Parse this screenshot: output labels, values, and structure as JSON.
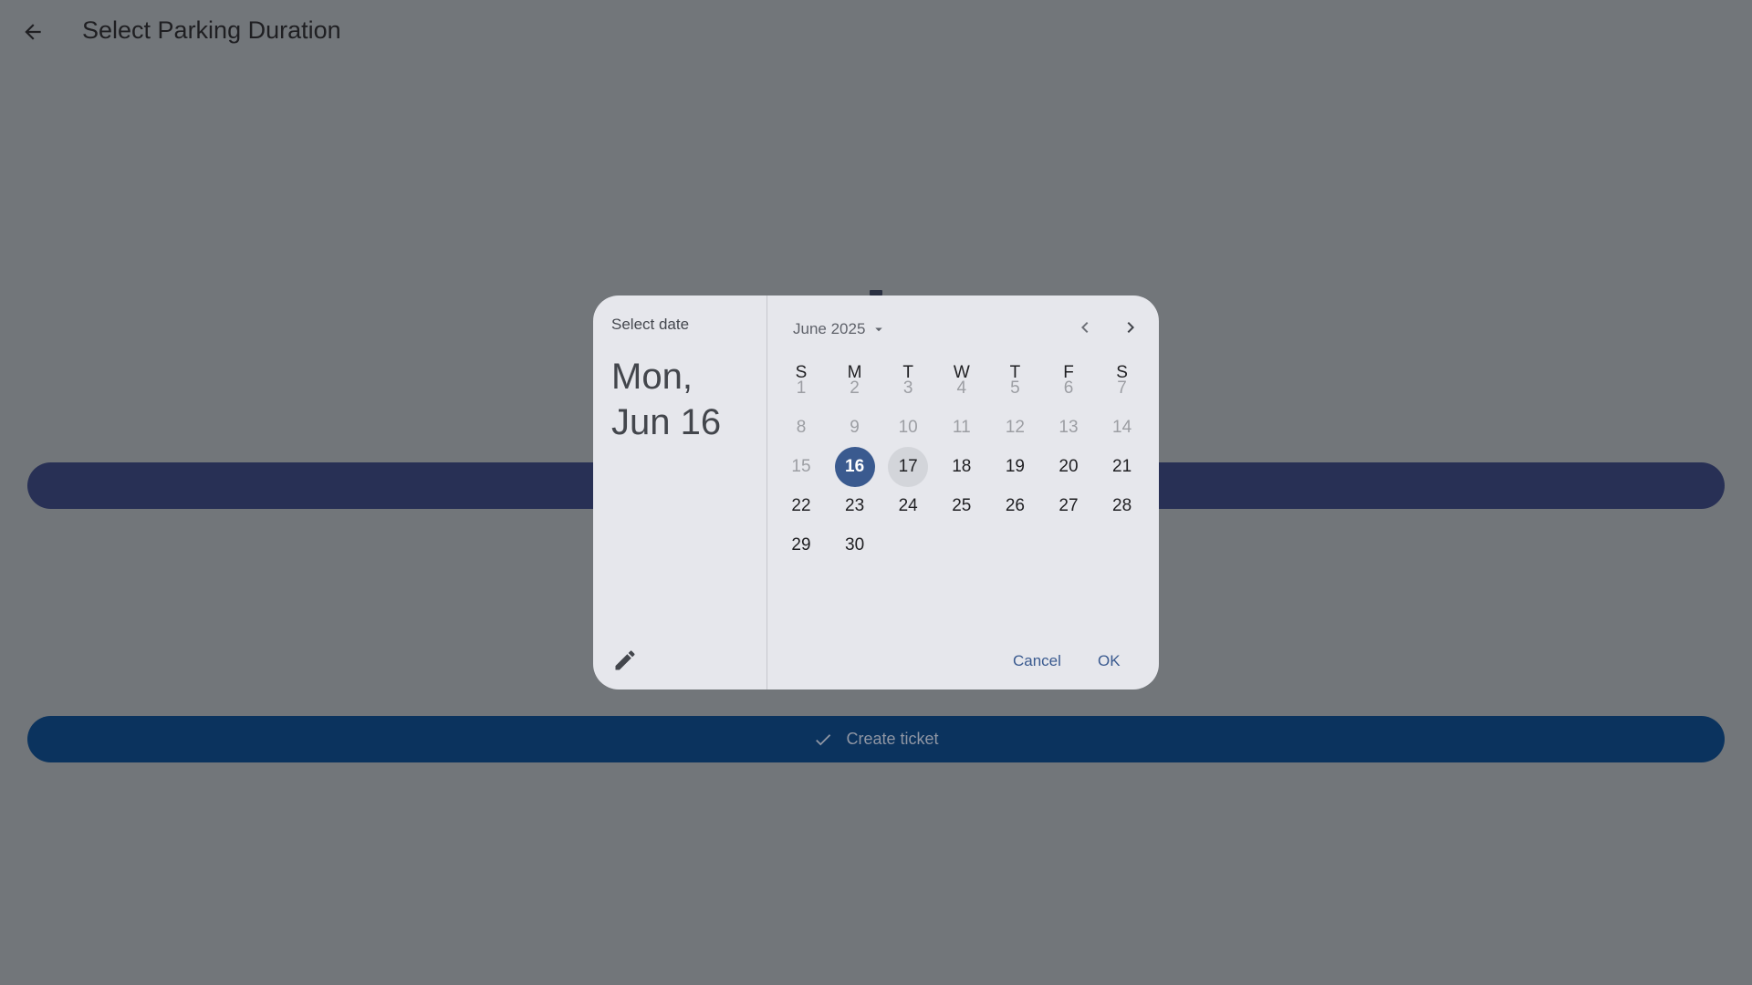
{
  "appbar": {
    "title": "Select Parking Duration",
    "back_icon": "arrow-left-icon"
  },
  "page": {
    "create_ticket_label": "Create ticket",
    "create_ticket_icon": "check-icon"
  },
  "date_picker": {
    "supporting_text": "Select date",
    "headline_line1": "Mon,",
    "headline_line2": "Jun 16",
    "month_label": "June 2025",
    "weekdays": [
      "S",
      "M",
      "T",
      "W",
      "T",
      "F",
      "S"
    ],
    "first_weekday_index": 0,
    "days_in_month": 30,
    "selected_day": 16,
    "hovered_day": 17,
    "first_enabled_day": 16,
    "cancel_label": "Cancel",
    "ok_label": "OK",
    "colors": {
      "selected_bg": "#3a5a8f",
      "accent_text": "#3a5a8f",
      "scrim": "#72767a"
    }
  }
}
